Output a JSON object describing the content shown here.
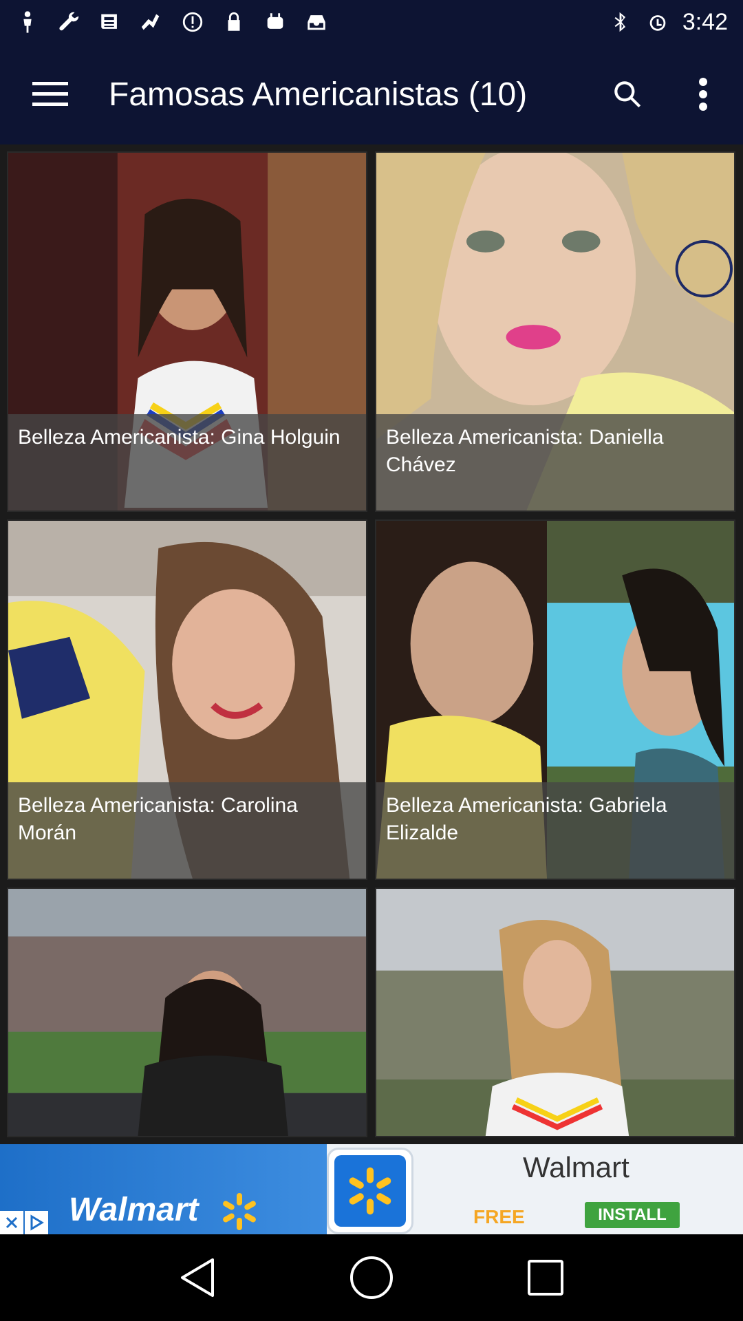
{
  "status_bar": {
    "time": "3:42",
    "left_icons": [
      "person-icon",
      "wrench-icon",
      "news-icon",
      "fax-icon",
      "info-icon",
      "lock-icon",
      "robot-icon",
      "inbox-icon"
    ],
    "right_icons": [
      "bluetooth-icon",
      "alarm-icon"
    ]
  },
  "app_bar": {
    "title": "Famosas Americanistas (10)"
  },
  "gallery": {
    "items": [
      {
        "caption": "Belleza Americanista: Gina Holguin",
        "bg": "#6b2a24"
      },
      {
        "caption": "Belleza Americanista: Daniella Chávez",
        "bg": "#c9b79a"
      },
      {
        "caption": "Belleza Americanista: Carolina Morán",
        "bg": "#8c6a4f"
      },
      {
        "caption": "Belleza Americanista: Gabriela Elizalde",
        "bg": "#4d7f8a"
      },
      {
        "caption": "",
        "bg": "#5b6a58"
      },
      {
        "caption": "",
        "bg": "#9aa0a6"
      }
    ]
  },
  "ad": {
    "logo_text": "Walmart",
    "brand": "Walmart",
    "free_label": "FREE",
    "install_label": "INSTALL",
    "accent": "#1e6fc8",
    "spark": "#ffc220"
  },
  "colors": {
    "app_bar": "#0d1433",
    "background": "#1b1b1b"
  }
}
